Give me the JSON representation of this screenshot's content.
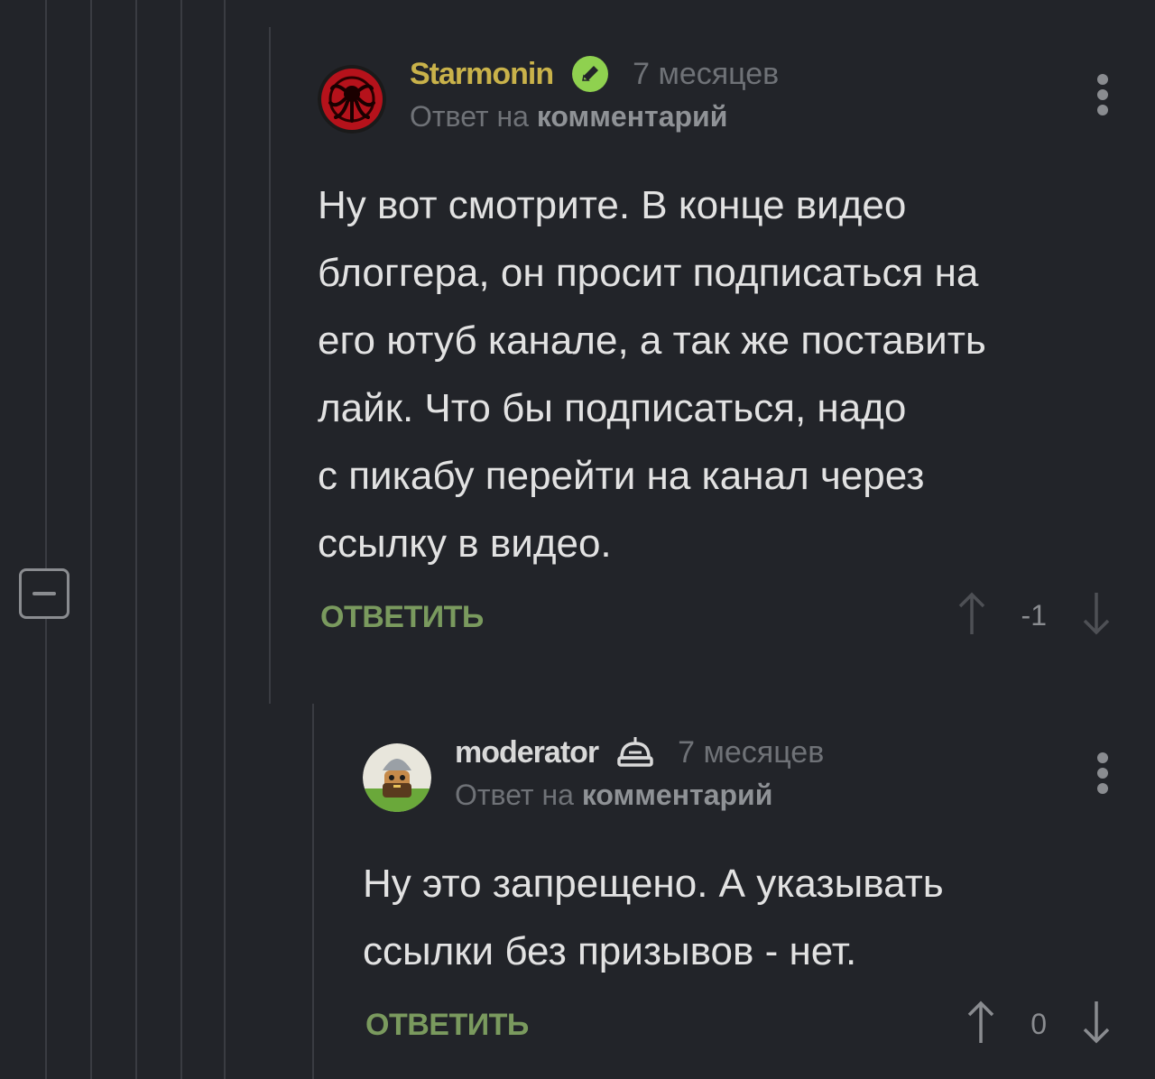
{
  "colors": {
    "background": "#222429",
    "username_gold": "#c9b24a",
    "reply_green": "#7a9a5e",
    "muted": "#6f7277",
    "thread_line": "#3a3c42"
  },
  "comments": [
    {
      "username": "Starmonin",
      "badge_icon": "verified-check-icon",
      "time": "7 месяцев",
      "reply_prefix": "Ответ на",
      "reply_target": "комментарий",
      "lines": [
        "Ну вот смотрите. В конце видео",
        "блоггера, он просит подписаться на",
        "его ютуб канале, а так же поставить",
        "лайк. Что бы подписаться, надо",
        "с пикабу перейти на канал через",
        "ссылку в видео."
      ],
      "reply_label": "ОТВЕТИТЬ",
      "score": "-1"
    },
    {
      "username": "moderator",
      "badge_icon": "moderator-helmet-icon",
      "time": "7 месяцев",
      "reply_prefix": "Ответ на",
      "reply_target": "комментарий",
      "lines": [
        "Ну это запрещено. А указывать",
        "ссылки без призывов - нет."
      ],
      "reply_label": "ОТВЕТИТЬ",
      "score": "0"
    }
  ]
}
